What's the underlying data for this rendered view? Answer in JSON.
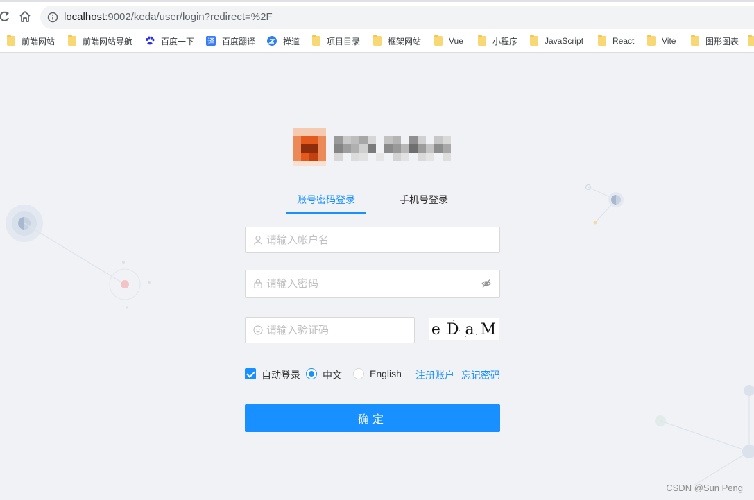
{
  "browser": {
    "url_host": "localhost",
    "url_path": ":9002/keda/user/login?redirect=%2F",
    "bookmarks": [
      {
        "icon": "folder-icon",
        "label": "前端网站"
      },
      {
        "icon": "folder-icon",
        "label": "前端网站导航"
      },
      {
        "icon": "baidu-paw-icon",
        "label": "百度一下"
      },
      {
        "icon": "translate-icon",
        "label": "百度翻译"
      },
      {
        "icon": "zen-icon",
        "label": "禅道"
      },
      {
        "icon": "folder-icon",
        "label": "项目目录"
      },
      {
        "icon": "folder-icon",
        "label": "框架网站"
      },
      {
        "icon": "folder-icon",
        "label": "Vue"
      },
      {
        "icon": "folder-icon",
        "label": "小程序"
      },
      {
        "icon": "folder-icon",
        "label": "JavaScript"
      },
      {
        "icon": "folder-icon",
        "label": "React"
      },
      {
        "icon": "folder-icon",
        "label": "Vite"
      },
      {
        "icon": "folder-icon",
        "label": "图形图表"
      }
    ]
  },
  "login": {
    "tabs": [
      {
        "label": "账号密码登录",
        "active": true
      },
      {
        "label": "手机号登录",
        "active": false
      }
    ],
    "username": {
      "value": "",
      "placeholder": "请输入帐户名"
    },
    "password": {
      "value": "",
      "placeholder": "请输入密码"
    },
    "captcha": {
      "value": "",
      "placeholder": "请输入验证码",
      "image_text": "e D a M"
    },
    "auto_login": {
      "label": "自动登录",
      "checked": true
    },
    "language": {
      "options": [
        "中文",
        "English"
      ],
      "selected": "中文"
    },
    "register_link": "注册账户",
    "forgot_link": "忘记密码",
    "submit_label": "确定"
  },
  "watermark": "CSDN @Sun   Peng",
  "colors": {
    "primary": "#1890ff",
    "background": "#f0f2f5",
    "logo_orange": "#e8541e"
  }
}
